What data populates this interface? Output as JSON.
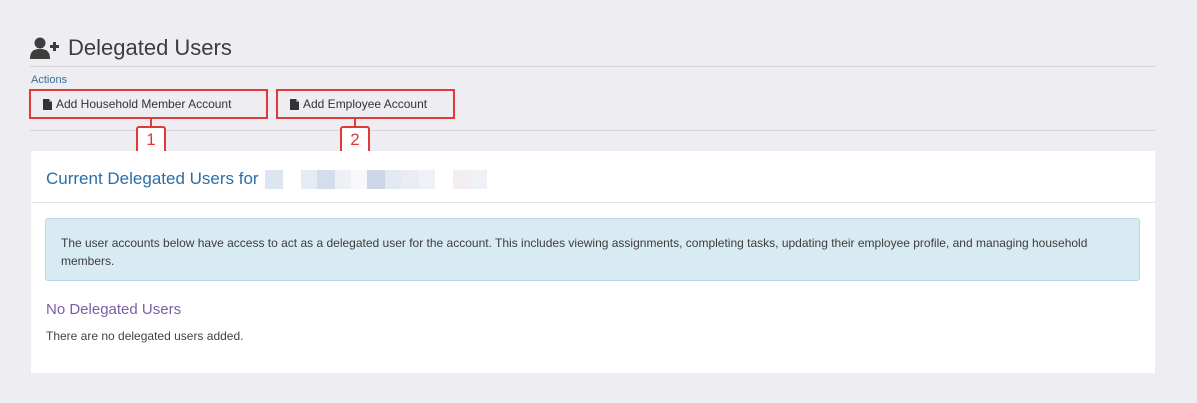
{
  "page": {
    "title": "Delegated Users",
    "title_icon": "user-plus-icon"
  },
  "actions": {
    "label": "Actions",
    "buttons": [
      {
        "label": "Add Household Member Account",
        "icon": "file-icon",
        "callout": "1"
      },
      {
        "label": "Add Employee Account",
        "icon": "file-icon",
        "callout": "2"
      }
    ]
  },
  "panel": {
    "title": "Current Delegated Users for",
    "info_text": "The user accounts below have access to act as a delegated user for the account. This includes viewing assignments, completing tasks, updating their employee profile, and managing household members.",
    "empty_title": "No Delegated Users",
    "empty_text": "There are no delegated users added."
  },
  "colors": {
    "accent_red": "#e0383b",
    "title_blue": "#2a6ea8",
    "empty_purple": "#7a5ea8",
    "info_bg": "#d8eaf2"
  }
}
